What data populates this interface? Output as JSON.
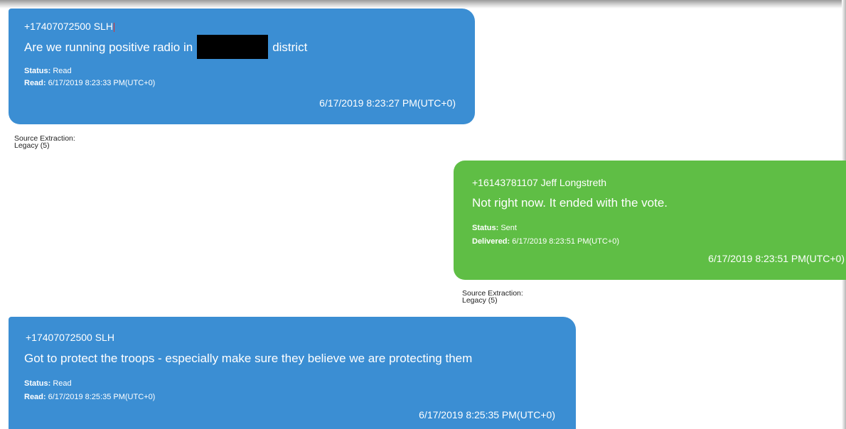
{
  "messages": [
    {
      "sender": "+17407072500 SLH",
      "text_before": "Are we running positive radio in",
      "text_after": "district",
      "status_label": "Status:",
      "status_value": "Read",
      "read_label": "Read:",
      "read_value": "6/17/2019 8:23:33 PM(UTC+0)",
      "timestamp": "6/17/2019 8:23:27 PM(UTC+0)",
      "color": "#3b8ed3"
    },
    {
      "sender": "+16143781107 Jeff Longstreth",
      "text": "Not right now. It ended with the vote.",
      "status_label": "Status:",
      "status_value": "Sent",
      "read_label": "Delivered:",
      "read_value": "6/17/2019 8:23:51 PM(UTC+0)",
      "timestamp": "6/17/2019 8:23:51 PM(UTC+0)",
      "color": "#5fbe45"
    },
    {
      "sender": "+17407072500 SLH",
      "text": "Got to protect the troops - especially make sure they believe we are protecting them",
      "status_label": "Status:",
      "status_value": "Read",
      "read_label": "Read:",
      "read_value": "6/17/2019 8:25:35 PM(UTC+0)",
      "timestamp": "6/17/2019 8:25:35 PM(UTC+0)",
      "color": "#3b8ed3"
    }
  ],
  "source_extractions": [
    {
      "label": "Source Extraction:",
      "value": "Legacy (5)"
    },
    {
      "label": "Source Extraction:",
      "value": "Legacy (5)"
    }
  ]
}
